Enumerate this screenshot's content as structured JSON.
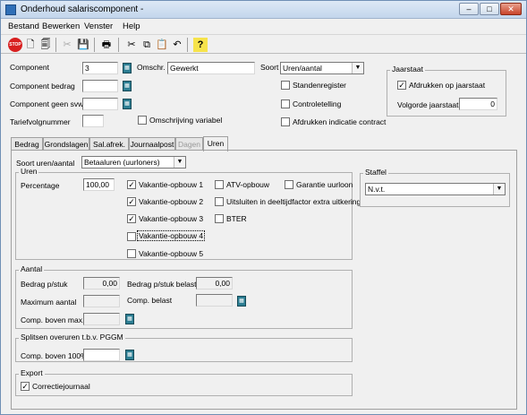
{
  "window": {
    "title": "Onderhoud salariscomponent -",
    "minimize": "–",
    "maximize": "□",
    "close": "✕"
  },
  "menu": [
    "Bestand",
    "Bewerken",
    "Venster",
    "Help"
  ],
  "toolbar": {
    "stop": "STOP",
    "new": "🗋",
    "copy_doc": "🗐",
    "delete": "✂",
    "save": "💾",
    "print": "🖶",
    "cut": "✂",
    "copy": "⧉",
    "paste": "📋",
    "undo": "↶",
    "help": "?"
  },
  "header": {
    "component_label": "Component",
    "component_value": "3",
    "omschr_label": "Omschr.",
    "omschr_value": "Gewerkt",
    "soort_label": "Soort",
    "soort_value": "Uren/aantal",
    "bedrag_label": "Component bedrag",
    "geen_svw_label": "Component geen svw",
    "tariefvolgnummer_label": "Tariefvolgnummer",
    "standenregister": "Standenregister",
    "controletelling": "Controletelling",
    "afdrukken_indicatie": "Afdrukken indicatie contract",
    "omschrijving_variabel": "Omschrijving variabel"
  },
  "jaarstaat": {
    "title": "Jaarstaat",
    "afdrukken": "Afdrukken op jaarstaat",
    "volgorde_label": "Volgorde jaarstaat",
    "volgorde_value": "0"
  },
  "tabs": [
    "Bedrag",
    "Grondslagen",
    "Sal.afrek.",
    "Journaalpost",
    "Dagen",
    "Uren"
  ],
  "uren_tab": {
    "soort_label": "Soort uren/aantal",
    "soort_value": "Betaaluren (uurloners)",
    "uren_group": "Uren",
    "percentage_label": "Percentage",
    "percentage_value": "100,00",
    "vakantie": [
      "Vakantie-opbouw 1",
      "Vakantie-opbouw 2",
      "Vakantie-opbouw 3",
      "Vakantie-opbouw 4",
      "Vakantie-opbouw 5"
    ],
    "atv": "ATV-opbouw",
    "garantie": "Garantie uurloon",
    "uitsluiten": "Uitsluiten in deeltijdfactor extra uitkering",
    "bter": "BTER",
    "staffel_group": "Staffel",
    "staffel_value": "N.v.t.",
    "aantal_group": "Aantal",
    "bedrag_pstuk_label": "Bedrag p/stuk",
    "bedrag_pstuk_value": "0,00",
    "bedrag_pstuk_belast_label": "Bedrag p/stuk belast",
    "bedrag_pstuk_belast_value": "0,00",
    "max_aantal_label": "Maximum aantal",
    "comp_belast_label": "Comp. belast",
    "comp_boven_max_label": "Comp. boven max.",
    "splitsen_group": "Splitsen overuren t.b.v. PGGM",
    "comp_boven_100_label": "Comp. boven 100%",
    "export_group": "Export",
    "correctiejournaal": "Correctiejournaal"
  }
}
